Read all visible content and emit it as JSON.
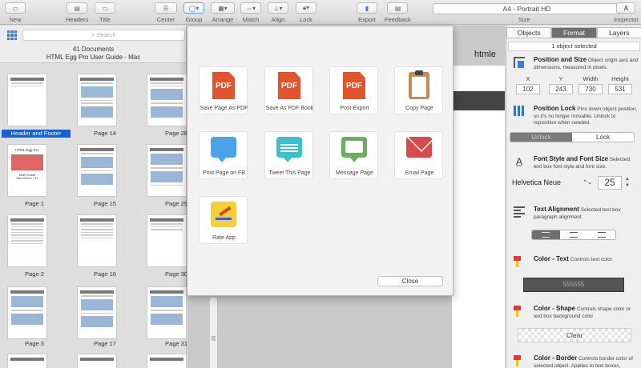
{
  "toolbar": {
    "new": "New",
    "headers": "Headers",
    "title": "Title",
    "center": "Center",
    "group": "Group",
    "arrange": "Arrange",
    "match": "Match",
    "align": "Align",
    "lock": "Lock",
    "export": "Export",
    "feedback": "Feedback",
    "page_size": "A4 - Portrait HD",
    "size_label": "Size",
    "inspector": "Inspector"
  },
  "sidebar": {
    "search_placeholder": "Search",
    "doc_count": "41 Documents",
    "doc_title": "HTML Egg Pro User Guide - Mac",
    "pages": [
      {
        "label": "Header and Footer",
        "selected": true
      },
      {
        "label": "Page 14"
      },
      {
        "label": "Page 28"
      },
      {
        "label": "Page 1"
      },
      {
        "label": "Page 15"
      },
      {
        "label": "Page 29"
      },
      {
        "label": "Page 2"
      },
      {
        "label": "Page 16"
      },
      {
        "label": "Page 30"
      },
      {
        "label": "Page 3"
      },
      {
        "label": "Page 17"
      },
      {
        "label": "Page 31"
      }
    ],
    "page1_cover": {
      "line1": "HTML Egg Pro",
      "line2": "User Guide",
      "line3": "Mac Version 7.10"
    }
  },
  "canvas": {
    "heading": "htmle",
    "ruler_mark": "20"
  },
  "share": {
    "items": [
      {
        "label": "Save Page As PDF",
        "icon": "pdf-icon",
        "badge": "PDF"
      },
      {
        "label": "Save As PDF Book",
        "icon": "pdf-book-icon",
        "badge": "PDF"
      },
      {
        "label": "Post Export",
        "icon": "pdf-export-icon",
        "badge": "PDF"
      },
      {
        "label": "Copy Page",
        "icon": "clipboard-icon"
      },
      {
        "label": "Post Page on FB",
        "icon": "facebook-bubble-icon"
      },
      {
        "label": "Tweet This Page",
        "icon": "tweet-bubble-icon"
      },
      {
        "label": "Message Page",
        "icon": "message-bubble-icon"
      },
      {
        "label": "Email Page",
        "icon": "email-icon"
      },
      {
        "label": "Rate App",
        "icon": "rate-app-icon"
      }
    ],
    "close": "Close"
  },
  "inspector": {
    "tabs": [
      "Objects",
      "Format",
      "Layers"
    ],
    "active_tab": "Format",
    "object_selected": "1 object selected",
    "position": {
      "title": "Position and Size",
      "desc": "Object origin axis and dimensions, measured in pixels.",
      "x_label": "X",
      "x": "102",
      "y_label": "Y",
      "y": "243",
      "w_label": "Width",
      "w": "730",
      "h_label": "Height",
      "h": "531"
    },
    "lock": {
      "title": "Position Lock",
      "desc": "Pins down object position, so it's no longer movable.  Unlock to reposition when needed.",
      "unlock": "Unlock",
      "lock": "Lock"
    },
    "font": {
      "title": "Font Style and Font Size",
      "desc": "Selected text box font style and font size.",
      "family": "Helvetica Neue",
      "size": "25"
    },
    "text_align": {
      "title": "Text Alignment",
      "desc": "Selected text box paragraph alignment"
    },
    "color_text": {
      "title": "Color - Text",
      "desc": "Controls text color",
      "value": "555555"
    },
    "color_shape": {
      "title": "Color - Shape",
      "desc": "Controls shape color or text box background color",
      "clear": "Clear"
    },
    "color_border": {
      "title": "Color - Border",
      "desc": "Controls border color of selected object.  Applies to text boxes,"
    }
  },
  "colors": {
    "selection": "#1361d4",
    "pdf": "#e0552e",
    "text_color": "#555555"
  }
}
